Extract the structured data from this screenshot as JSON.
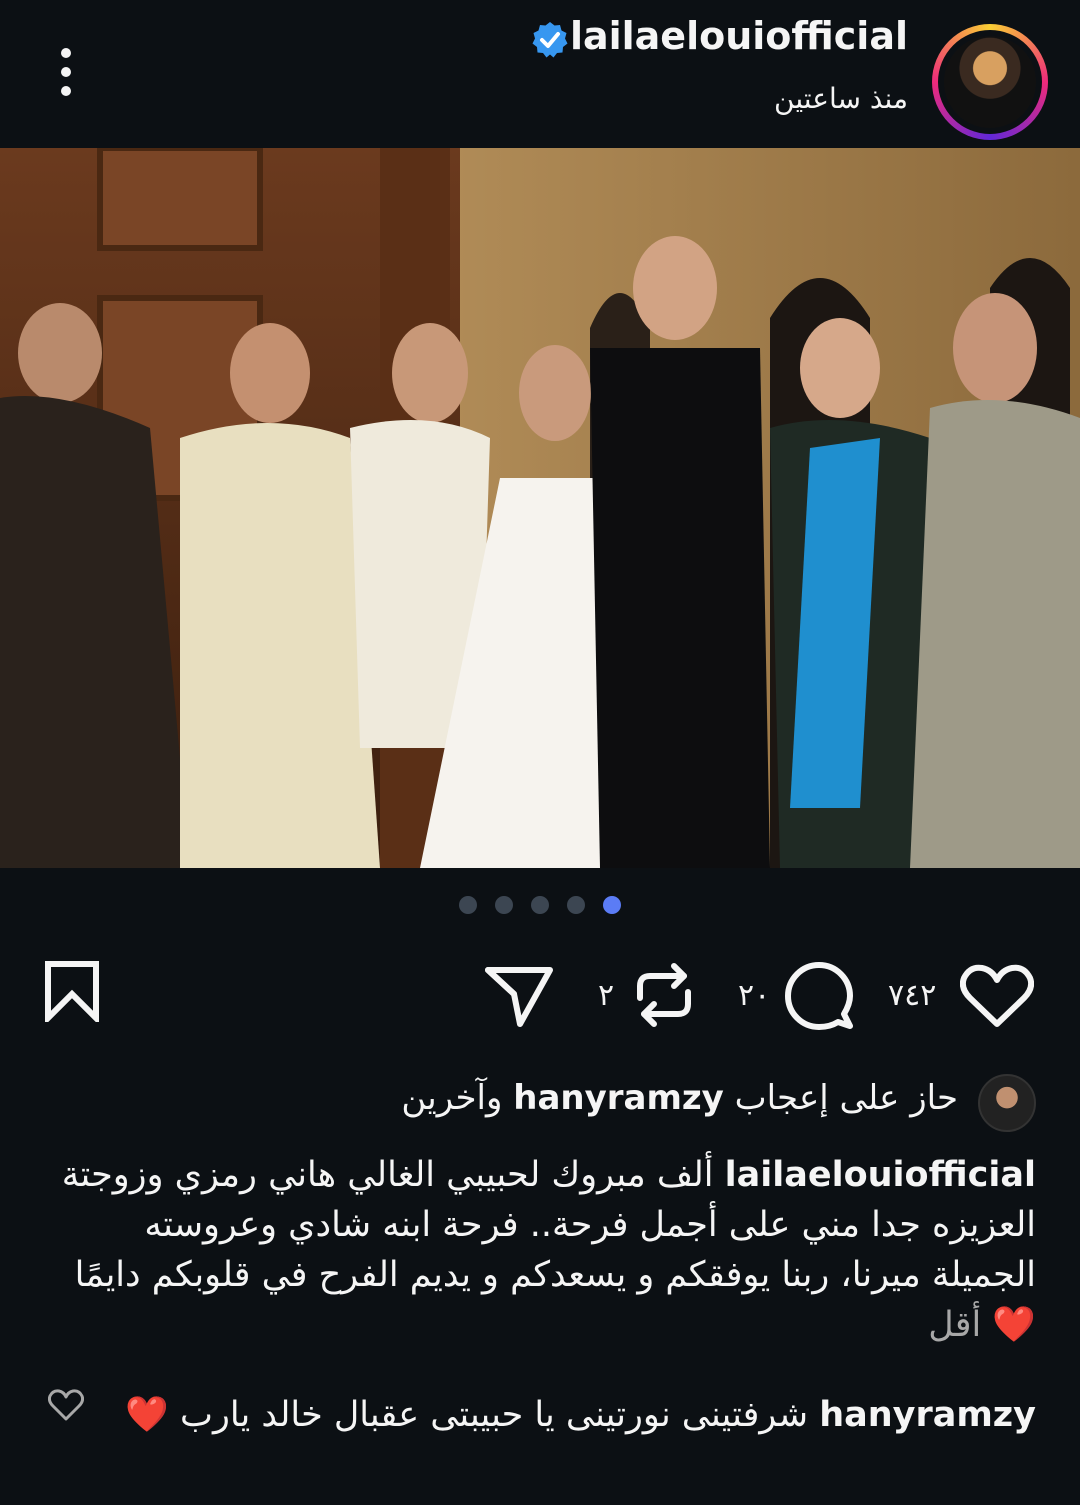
{
  "post": {
    "username": "lailaelouiofficial",
    "time": "منذ ساعتين"
  },
  "carousel": {
    "count": 5,
    "active_index": 4
  },
  "actions": {
    "likes_count": "٧٤٢",
    "comments_count": "٢٠",
    "reposts_count": "٢"
  },
  "liked_by": {
    "prefix": "حاز على إعجاب",
    "user": "hanyramzy",
    "suffix": "وآخرين"
  },
  "caption": {
    "username": "lailaelouiofficial",
    "text": "ألف مبروك لحبيبي الغالي هاني رمزي وزوجتة العزيزه جدا مني على أجمل فرحة.. فرحة ابنه شادي وعروسته الجميلة ميرنا، ربنا يوفقكم و يسعدكم و يديم الفرح في قلوبكم دايمًا",
    "emoji": "❤️",
    "less_label": "أقل"
  },
  "comment": {
    "username": "hanyramzy",
    "text": "شرفتينى نورتينى يا حبيبتى عقبال خالد يارب",
    "emoji": "❤️"
  },
  "colors": {
    "background": "#0c1014",
    "text": "#f5f5f5",
    "muted": "#a8a8a8",
    "verified": "#3797f0",
    "active_dot": "#5b7cf5"
  }
}
